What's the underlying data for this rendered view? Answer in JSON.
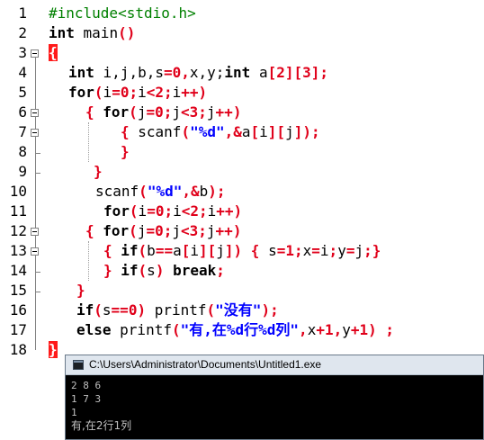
{
  "line_numbers": [
    "1",
    "2",
    "3",
    "4",
    "5",
    "6",
    "7",
    "8",
    "9",
    "10",
    "11",
    "12",
    "13",
    "14",
    "15",
    "16",
    "17",
    "18"
  ],
  "code": {
    "l1": "#include<stdio.h>",
    "l2a": "int",
    "l2b": " main",
    "l2c": "()",
    "l3": "{",
    "l4a": "int",
    "l4b": " i,j,b,s",
    "l4c": "=0,",
    "l4d": "x,y;",
    "l4e": "int",
    "l4f": " a",
    "l4g": "[2][3];",
    "l5a": "for",
    "l5b": "(",
    "l5c": "i",
    "l5d": "=0;",
    "l5e": "i",
    "l5f": "<2;",
    "l5g": "i",
    "l5h": "++)",
    "l6a": "{ ",
    "l6b": "for",
    "l6c": "(",
    "l6d": "j",
    "l6e": "=0;",
    "l6f": "j",
    "l6g": "<3;",
    "l6h": "j",
    "l6i": "++)",
    "l7a": "{ ",
    "l7b": "scanf",
    "l7c": "(",
    "l7d": "\"%d\"",
    "l7e": ",&",
    "l7f": "a",
    "l7g": "[",
    "l7h": "i",
    "l7i": "][",
    "l7j": "j",
    "l7k": "]);",
    "l8": "}",
    "l9": "}",
    "l10a": "scanf",
    "l10b": "(",
    "l10c": "\"%d\"",
    "l10d": ",&",
    "l10e": "b",
    "l10f": ");",
    "l11a": "for",
    "l11b": "(",
    "l11c": "i",
    "l11d": "=0;",
    "l11e": "i",
    "l11f": "<2;",
    "l11g": "i",
    "l11h": "++)",
    "l12a": "{ ",
    "l12b": "for",
    "l12c": "(",
    "l12d": "j",
    "l12e": "=0;",
    "l12f": "j",
    "l12g": "<3;",
    "l12h": "j",
    "l12i": "++)",
    "l13a": "{ ",
    "l13b": "if",
    "l13c": "(",
    "l13d": "b",
    "l13e": "==",
    "l13f": "a",
    "l13g": "[",
    "l13h": "i",
    "l13i": "][",
    "l13j": "j",
    "l13k": "]) { ",
    "l13l": "s",
    "l13m": "=1;",
    "l13n": "x",
    "l13o": "=",
    "l13p": "i",
    "l13q": ";",
    "l13r": "y",
    "l13s": "=",
    "l13t": "j",
    "l13u": ";}",
    "l14a": "} ",
    "l14b": "if",
    "l14c": "(",
    "l14d": "s",
    "l14e": ") ",
    "l14f": "break",
    "l14g": ";",
    "l15": "}",
    "l16a": "if",
    "l16b": "(",
    "l16c": "s",
    "l16d": "==0) ",
    "l16e": "printf",
    "l16f": "(",
    "l16g": "\"没有\"",
    "l16h": ");",
    "l17a": "else",
    "l17b": " printf",
    "l17c": "(",
    "l17d": "\"有,在%d行%d列\"",
    "l17e": ",",
    "l17f": "x",
    "l17g": "+1,",
    "l17h": "y",
    "l17i": "+1) ;",
    "l18": "}"
  },
  "console": {
    "title": "C:\\Users\\Administrator\\Documents\\Untitled1.exe",
    "lines": [
      "2 8 6",
      "1 7 3",
      "1",
      "有,在2行1列"
    ]
  },
  "colors": {
    "keyword": "#000000",
    "operator": "#e0001a",
    "string": "#0000ff",
    "preprocessor": "#008000",
    "console_bg": "#000000",
    "console_text": "#c0c0c0"
  }
}
